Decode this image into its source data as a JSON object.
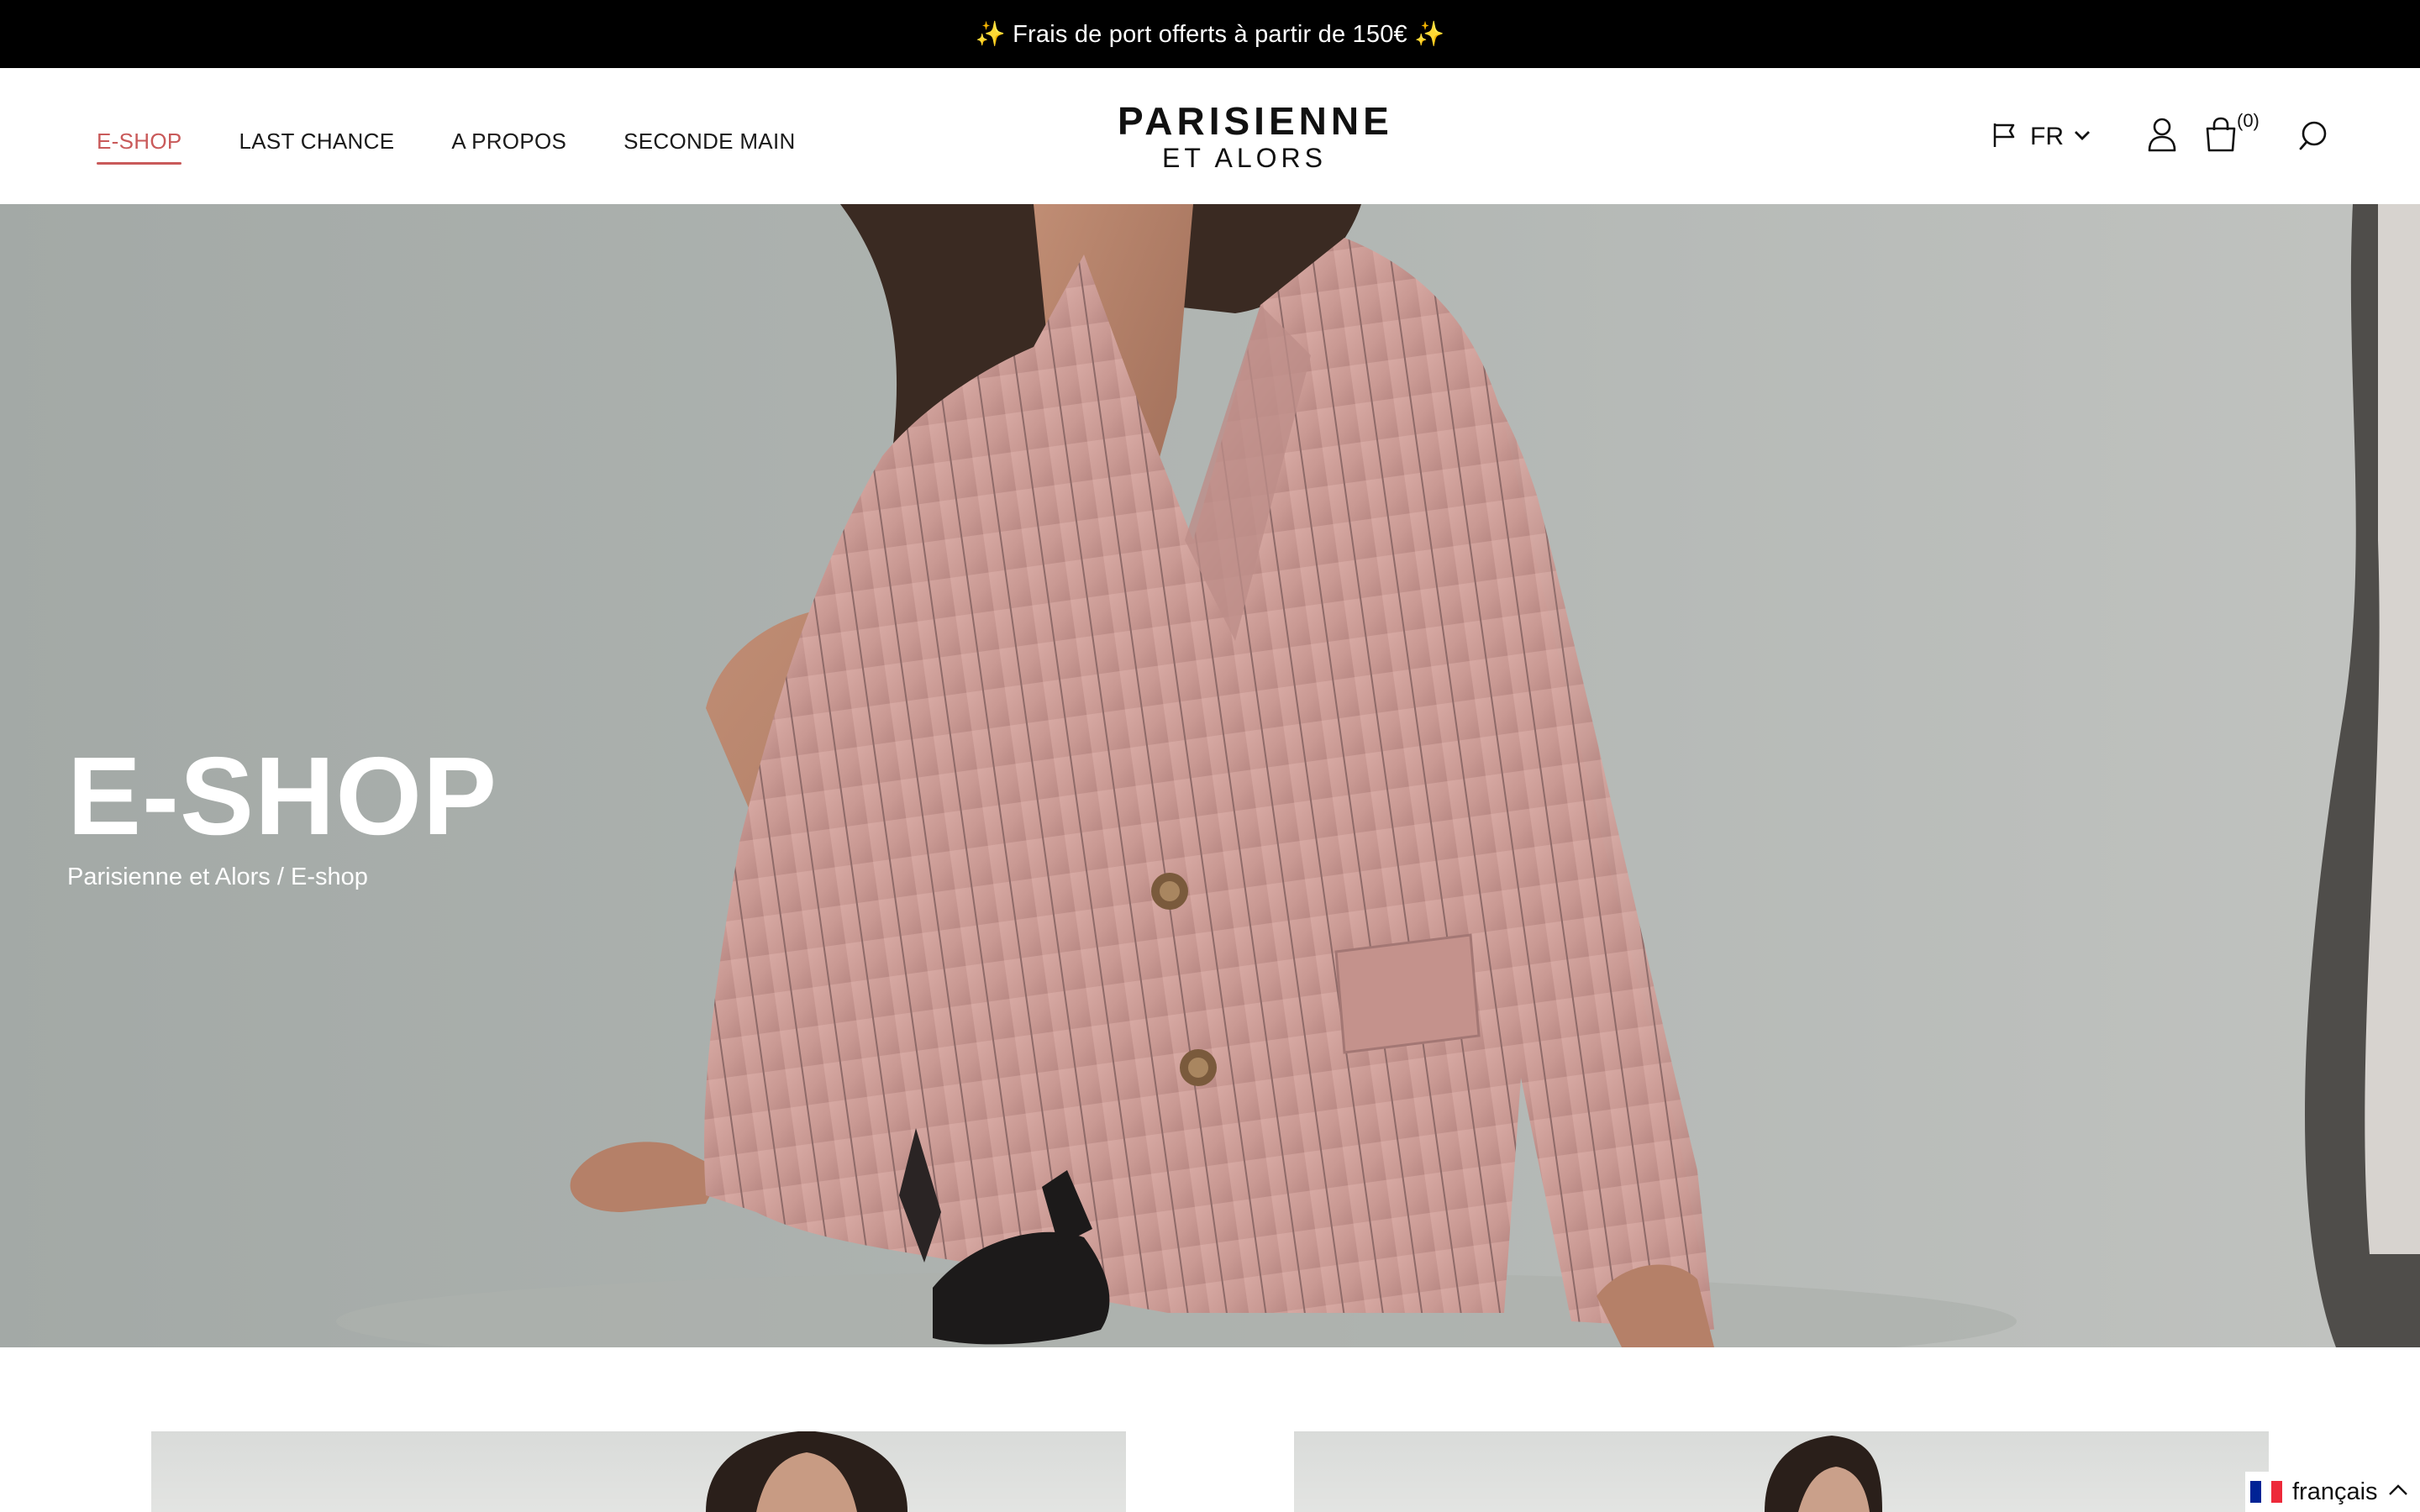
{
  "announcement": {
    "text": "✨ Frais de port offerts à partir de 150€ ✨"
  },
  "nav": {
    "items": [
      {
        "label": "E-SHOP",
        "active": true
      },
      {
        "label": "LAST CHANCE",
        "active": false
      },
      {
        "label": "A PROPOS",
        "active": false
      },
      {
        "label": "SECONDE MAIN",
        "active": false
      }
    ]
  },
  "logo": {
    "line1": "PARISIENNE",
    "line2": "ET ALORS"
  },
  "header_tools": {
    "language_code": "FR",
    "cart_count": "(0)",
    "icons": [
      "flag-icon",
      "chevron-down-icon",
      "account-icon",
      "cart-icon",
      "search-icon"
    ]
  },
  "hero": {
    "title": "E-SHOP",
    "breadcrumb": {
      "home": "Parisienne et Alors",
      "separator": " / ",
      "current": "E-shop"
    }
  },
  "language_widget": {
    "label": "français",
    "flag_colors": [
      "#002395",
      "#ffffff",
      "#ed2939"
    ]
  },
  "colors": {
    "accent": "#c95a5a",
    "announcement_bg": "#000000"
  }
}
